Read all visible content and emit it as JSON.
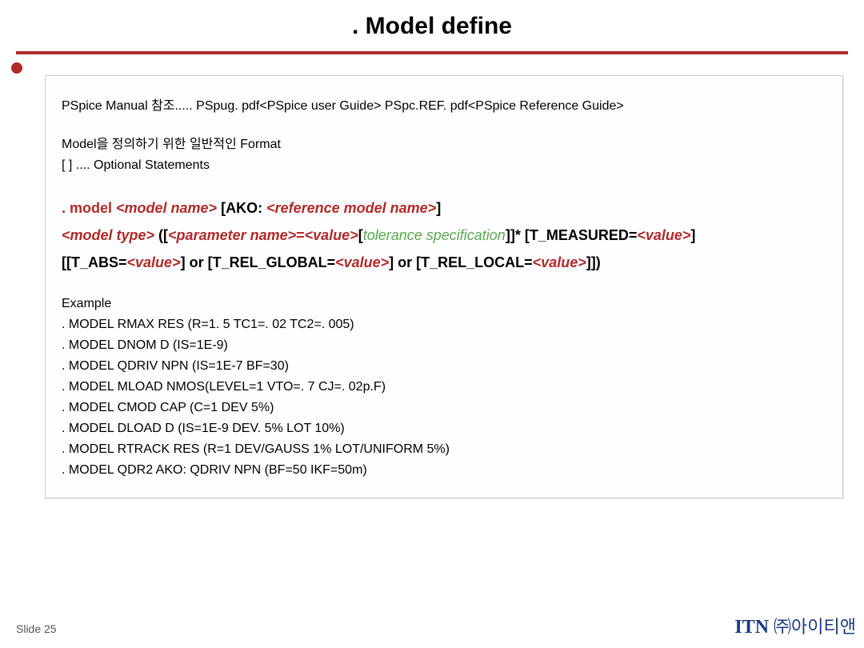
{
  "title": ". Model define",
  "box": {
    "ref_line": "PSpice Manual 참조..... PSpug. pdf<PSpice user Guide>  PSpc.REF. pdf<PSpice Reference Guide>",
    "format_heading": "Model을 정의하기 위한 일반적인 Format",
    "optional_line": "[    ] .... Optional Statements",
    "syntax": {
      "l1_kw": ". model ",
      "l1_ital1": "<model name>",
      "l1_brk1": " [AKO: ",
      "l1_ital2": "<reference model name>",
      "l1_brk2": "]",
      "l2_ital1": "<model type>",
      "l2_brk1": " ([",
      "l2_ital2": "<parameter name>",
      "l2_eq": "=",
      "l2_ital3": "<value>",
      "l2_brk2": "[",
      "l2_green": "tolerance specification",
      "l2_brk3": "]]* [T_MEASURED=",
      "l2_ital4": "<value>",
      "l2_brk4": "]",
      "l3_brk1": " [[T_ABS=",
      "l3_ital1": "<value>",
      "l3_mid1": "] or [T_REL_GLOBAL=",
      "l3_ital2": "<value>",
      "l3_mid2": "] or [T_REL_LOCAL=",
      "l3_ital3": "<value>",
      "l3_end": "]])"
    },
    "example_heading": "Example",
    "examples": [
      ". MODEL RMAX RES (R=1. 5 TC1=. 02 TC2=. 005)",
      ". MODEL DNOM D (IS=1E-9)",
      ". MODEL QDRIV NPN (IS=1E-7 BF=30)",
      ". MODEL MLOAD NMOS(LEVEL=1 VTO=. 7 CJ=. 02p.F)",
      ". MODEL CMOD CAP (C=1 DEV 5%)",
      ". MODEL DLOAD D (IS=1E-9 DEV. 5% LOT 10%)",
      ". MODEL RTRACK RES (R=1 DEV/GAUSS 1% LOT/UNIFORM 5%)",
      ". MODEL QDR2 AKO: QDRIV NPN (BF=50 IKF=50m)"
    ]
  },
  "footer": {
    "left": "Slide 25",
    "right_en": "ITN ",
    "right_kr": "㈜아이티앤"
  }
}
